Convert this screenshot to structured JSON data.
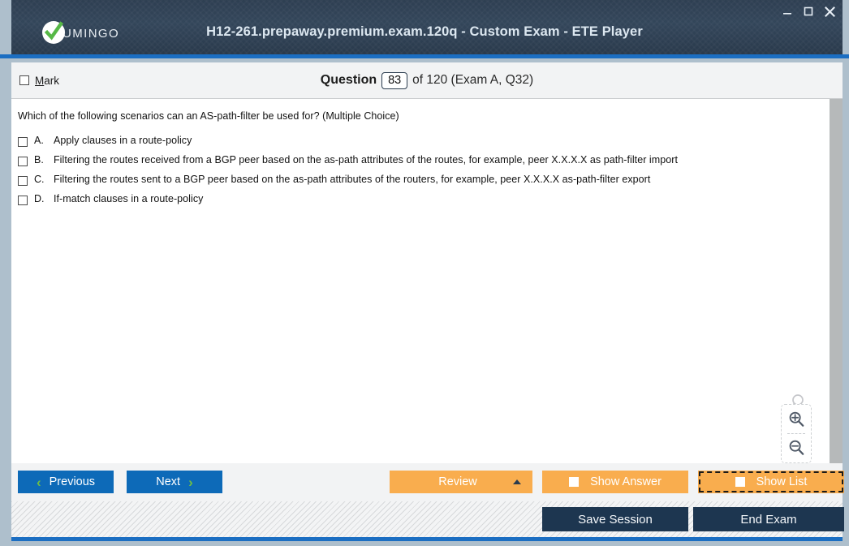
{
  "window": {
    "title": "H12-261.prepaway.premium.exam.120q - Custom Exam - ETE Player",
    "logo_text": "UMINGO",
    "controls": {
      "minimize": "minimize-icon",
      "maximize": "maximize-icon",
      "close": "close-icon"
    },
    "accent_color": "#1b6ec2",
    "titlebar_color": "#2e3f52"
  },
  "question_bar": {
    "mark_label_prefix": "M",
    "mark_label_rest": "ark",
    "mark_checked": false,
    "question_word": "Question",
    "current_number": "83",
    "of_text": "of 120 (Exam A, Q32)"
  },
  "question": {
    "text": "Which of the following scenarios can an AS-path-filter be used for? (Multiple Choice)",
    "options": [
      {
        "letter": "A.",
        "text": "Apply clauses in a route-policy",
        "checked": false
      },
      {
        "letter": "B.",
        "text": "Filtering the routes received from a BGP peer based on the as-path attributes of the routes, for example, peer X.X.X.X as path-filter import",
        "checked": false
      },
      {
        "letter": "C.",
        "text": "Filtering the routes sent to a BGP peer based on the as-path attributes of the routers, for example, peer X.X.X.X as-path-filter export",
        "checked": false
      },
      {
        "letter": "D.",
        "text": "If-match clauses in a route-policy",
        "checked": false
      }
    ]
  },
  "zoom_controls": {
    "reset_icon": "magnifier-icon",
    "zoom_in_icon": "zoom-in-icon",
    "zoom_out_icon": "zoom-out-icon"
  },
  "navbar": {
    "previous_label": "Previous",
    "next_label": "Next",
    "review_label": "Review",
    "show_answer_label": "Show Answer",
    "show_list_label": "Show List",
    "blue_color": "#0d6ab8",
    "orange_color": "#f9ad4e",
    "chevron_color": "#6fbe44"
  },
  "footer": {
    "save_session_label": "Save Session",
    "end_exam_label": "End Exam",
    "button_color": "#1d3650"
  }
}
